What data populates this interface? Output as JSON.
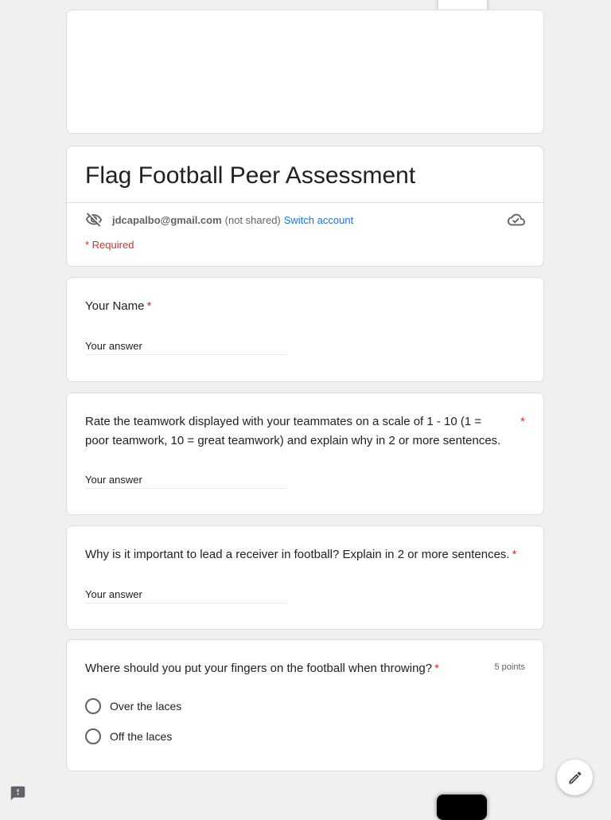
{
  "form": {
    "title": "Flag Football Peer Assessment",
    "account": {
      "email": "jdcapalbo@gmail.com",
      "status": "(not shared)",
      "switch_label": "Switch account"
    },
    "required_note": "* Required"
  },
  "questions": [
    {
      "title": "Your Name",
      "required_star": "*",
      "answer_placeholder": "Your answer"
    },
    {
      "title": "Rate the teamwork displayed with your teammates on a scale of 1 - 10 (1 = poor teamwork, 10 = great teamwork) and explain why in 2 or more sentences.",
      "required_star": "*",
      "answer_placeholder": "Your answer"
    },
    {
      "title": "Why is it important to lead a receiver in football? Explain in 2 or more sentences.",
      "required_star": "*",
      "answer_placeholder": "Your answer"
    },
    {
      "title": "Where should you put your fingers on the football when throwing?",
      "required_star": "*",
      "points": "5 points",
      "options": [
        "Over the laces",
        "Off the laces"
      ]
    }
  ],
  "icons": {
    "visibility": "visibility-off-icon",
    "cloud": "cloud-done-icon",
    "edit": "pencil-icon",
    "feedback": "feedback-icon"
  },
  "colors": {
    "background": "#f0f0f0",
    "required": "#d93025",
    "link": "#1a73e8",
    "text": "#202124",
    "muted": "#5f6368"
  }
}
